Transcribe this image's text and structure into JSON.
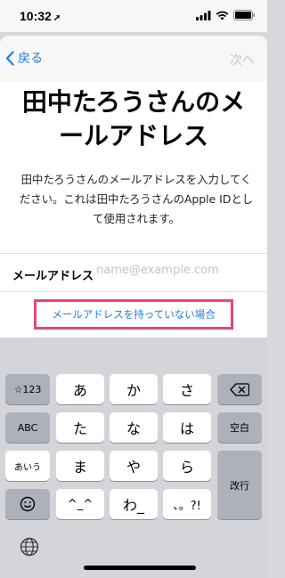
{
  "status": {
    "time": "10:32"
  },
  "nav": {
    "back_label": "戻る",
    "next_label": "次へ"
  },
  "title": "田中たろうさんのメールアドレス",
  "description": "田中たろうさんのメールアドレスを入力してください。これは田中たろうさんのApple IDとして使用されます。",
  "field": {
    "label": "メールアドレス",
    "placeholder": "name@example.com",
    "value": ""
  },
  "no_email_link": "メールアドレスを持っていない場合",
  "colors": {
    "accent": "#1a7fe6",
    "highlight_border": "#e8457f"
  },
  "keyboard": {
    "left_column": [
      "☆123",
      "ABC",
      "あいう",
      "emoji"
    ],
    "row1": [
      "あ",
      "か",
      "さ"
    ],
    "row2": [
      "た",
      "な",
      "は"
    ],
    "row3": [
      "ま",
      "や",
      "ら"
    ],
    "row4": [
      "^_^",
      "わ_",
      "、。?!"
    ],
    "right_column": [
      "backspace",
      "空白",
      "改行"
    ]
  }
}
